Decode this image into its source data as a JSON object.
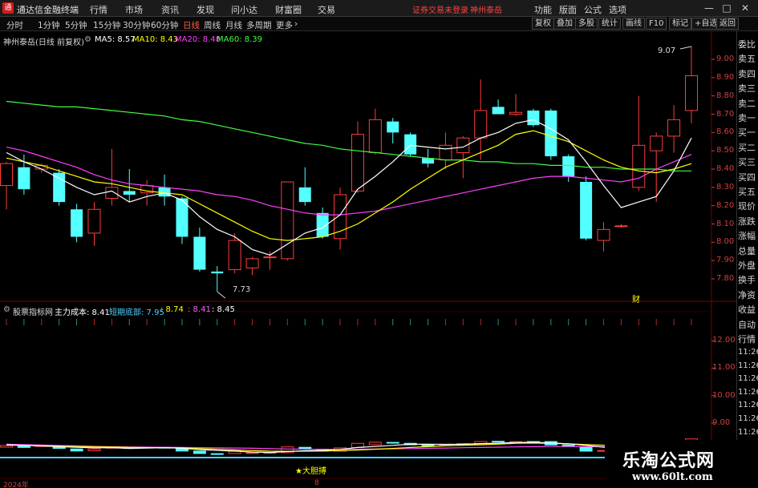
{
  "app": {
    "logo_char": "通",
    "title": "通达信金融终端",
    "menu": [
      "行情",
      "市场",
      "资讯",
      "发现",
      "问小达",
      "财富圈",
      "交易"
    ],
    "notice": "证券交易未登录",
    "notice_stock": "神州泰岳",
    "right_menu": [
      "功能",
      "版面",
      "公式",
      "选项"
    ],
    "window_buttons": [
      "—",
      "□",
      "✕"
    ]
  },
  "toolbar": {
    "periods": [
      "分时",
      "1分钟",
      "5分钟",
      "15分钟",
      "30分钟",
      "60分钟",
      "日线",
      "周线",
      "月线",
      "多周期",
      "更多"
    ],
    "active_period": "日线",
    "tools": [
      "复权",
      "叠加",
      "多股",
      "统计",
      "画线",
      "F10",
      "标记",
      "+自选",
      "返回"
    ]
  },
  "main_chart": {
    "stock_title": "神州泰岳(日线 前复权)",
    "ma5_label": "MA5: 8.57",
    "ma10_label": "MA10: 8.43",
    "ma20_label": "MA20: 8.48",
    "ma60_label": "MA60: 8.39",
    "high_marker": "9.07",
    "low_marker": "7.73",
    "event_marker": "财",
    "y_ticks": [
      "9.00",
      "8.90",
      "8.80",
      "8.70",
      "8.60",
      "8.50",
      "8.40",
      "8.30",
      "8.20",
      "8.10",
      "8.00",
      "7.90",
      "7.80"
    ]
  },
  "indicator": {
    "name": "股票指标网",
    "cost_label": "主力成本: 8.41",
    "bottom_label": "短期底部: 7.95",
    "v1": ": 8.74",
    "v2": ": 8.41",
    "v3": ": 8.45",
    "signal": "★大胆搏",
    "y_ticks": [
      "12.00",
      "11.00",
      "10.00",
      "9.00"
    ]
  },
  "side_panel": {
    "tabs": [
      "委比",
      "卖五",
      "卖四",
      "卖三",
      "卖二",
      "卖一",
      "买一",
      "买二",
      "买三",
      "买四",
      "买五",
      "现价",
      "涨跌",
      "涨幅",
      "总量",
      "外盘",
      "换手",
      "净资",
      "收益",
      "自动",
      "行情",
      "11:26",
      "11:26",
      "11:26",
      "11:26",
      "11:26",
      "11:26",
      "11:26",
      "11:26",
      "11:26",
      "11:26",
      "11:26"
    ]
  },
  "bottom": {
    "year": "2024年",
    "month": "8"
  },
  "watermark": {
    "title": "乐淘公式网",
    "url": "www.60lt.com"
  },
  "colors": {
    "up": "#ff3c3c",
    "down": "#54ffff",
    "ma5": "#ffffff",
    "ma10": "#ffff00",
    "ma20": "#ff40ff",
    "ma60": "#40ff40"
  },
  "candles": [
    {
      "o": 8.31,
      "h": 8.44,
      "l": 8.18,
      "c": 8.43
    },
    {
      "o": 8.41,
      "h": 8.48,
      "l": 8.26,
      "c": 8.29
    },
    {
      "o": 8.4,
      "h": 8.43,
      "l": 8.38,
      "c": 8.42
    },
    {
      "o": 8.38,
      "h": 8.4,
      "l": 8.2,
      "c": 8.22
    },
    {
      "o": 8.18,
      "h": 8.21,
      "l": 8.0,
      "c": 8.03
    },
    {
      "o": 8.05,
      "h": 8.22,
      "l": 7.98,
      "c": 8.18
    },
    {
      "o": 8.24,
      "h": 8.51,
      "l": 8.2,
      "c": 8.3
    },
    {
      "o": 8.28,
      "h": 8.4,
      "l": 8.22,
      "c": 8.26
    },
    {
      "o": 8.27,
      "h": 8.34,
      "l": 8.2,
      "c": 8.31
    },
    {
      "o": 8.3,
      "h": 8.37,
      "l": 8.2,
      "c": 8.25
    },
    {
      "o": 8.24,
      "h": 8.25,
      "l": 7.99,
      "c": 8.03
    },
    {
      "o": 8.03,
      "h": 8.08,
      "l": 7.84,
      "c": 7.85
    },
    {
      "o": 7.84,
      "h": 7.87,
      "l": 7.73,
      "c": 7.83
    },
    {
      "o": 7.85,
      "h": 8.05,
      "l": 7.83,
      "c": 8.01
    },
    {
      "o": 7.86,
      "h": 7.92,
      "l": 7.82,
      "c": 7.91
    },
    {
      "o": 7.92,
      "h": 7.95,
      "l": 7.85,
      "c": 7.92
    },
    {
      "o": 7.91,
      "h": 8.33,
      "l": 7.9,
      "c": 8.33
    },
    {
      "o": 8.3,
      "h": 8.41,
      "l": 8.2,
      "c": 8.22
    },
    {
      "o": 8.16,
      "h": 8.19,
      "l": 8.02,
      "c": 8.03
    },
    {
      "o": 8.02,
      "h": 8.3,
      "l": 7.96,
      "c": 8.26
    },
    {
      "o": 8.28,
      "h": 8.66,
      "l": 8.27,
      "c": 8.59
    },
    {
      "o": 8.49,
      "h": 8.73,
      "l": 8.48,
      "c": 8.67
    },
    {
      "o": 8.66,
      "h": 8.68,
      "l": 8.54,
      "c": 8.6
    },
    {
      "o": 8.59,
      "h": 8.6,
      "l": 8.47,
      "c": 8.48
    },
    {
      "o": 8.46,
      "h": 8.51,
      "l": 8.41,
      "c": 8.43
    },
    {
      "o": 8.45,
      "h": 8.6,
      "l": 8.4,
      "c": 8.53
    },
    {
      "o": 8.49,
      "h": 8.58,
      "l": 8.35,
      "c": 8.57
    },
    {
      "o": 8.57,
      "h": 8.89,
      "l": 8.45,
      "c": 8.72
    },
    {
      "o": 8.74,
      "h": 8.78,
      "l": 8.7,
      "c": 8.7
    },
    {
      "o": 8.7,
      "h": 8.81,
      "l": 8.69,
      "c": 8.71
    },
    {
      "o": 8.72,
      "h": 8.73,
      "l": 8.63,
      "c": 8.64
    },
    {
      "o": 8.72,
      "h": 8.73,
      "l": 8.45,
      "c": 8.47
    },
    {
      "o": 8.47,
      "h": 8.48,
      "l": 8.33,
      "c": 8.36
    },
    {
      "o": 8.33,
      "h": 8.36,
      "l": 8.01,
      "c": 8.02
    },
    {
      "o": 8.01,
      "h": 8.11,
      "l": 7.95,
      "c": 8.07
    },
    {
      "o": 8.09,
      "h": 8.1,
      "l": 8.08,
      "c": 8.09
    },
    {
      "o": 8.3,
      "h": 8.8,
      "l": 8.28,
      "c": 8.53
    },
    {
      "o": 8.5,
      "h": 8.6,
      "l": 8.22,
      "c": 8.58
    },
    {
      "o": 8.58,
      "h": 8.75,
      "l": 8.49,
      "c": 8.67
    },
    {
      "o": 8.72,
      "h": 9.07,
      "l": 8.65,
      "c": 8.91
    }
  ],
  "ma5": [
    8.49,
    8.44,
    8.4,
    8.35,
    8.3,
    8.26,
    8.28,
    8.22,
    8.25,
    8.27,
    8.23,
    8.14,
    8.07,
    8.03,
    7.96,
    7.93,
    7.99,
    8.05,
    8.08,
    8.15,
    8.29,
    8.36,
    8.44,
    8.53,
    8.52,
    8.51,
    8.52,
    8.57,
    8.6,
    8.65,
    8.67,
    8.62,
    8.56,
    8.44,
    8.31,
    8.19,
    8.22,
    8.25,
    8.39,
    8.57
  ],
  "ma10": [
    8.46,
    8.44,
    8.42,
    8.39,
    8.36,
    8.33,
    8.32,
    8.3,
    8.28,
    8.27,
    8.26,
    8.21,
    8.16,
    8.11,
    8.06,
    8.02,
    8.01,
    8.02,
    8.03,
    8.06,
    8.1,
    8.16,
    8.22,
    8.29,
    8.35,
    8.41,
    8.45,
    8.49,
    8.53,
    8.59,
    8.61,
    8.58,
    8.55,
    8.5,
    8.45,
    8.41,
    8.39,
    8.38,
    8.4,
    8.43
  ],
  "ma20": [
    8.52,
    8.5,
    8.47,
    8.44,
    8.41,
    8.37,
    8.34,
    8.32,
    8.31,
    8.3,
    8.29,
    8.28,
    8.26,
    8.25,
    8.23,
    8.2,
    8.18,
    8.16,
    8.15,
    8.15,
    8.16,
    8.17,
    8.19,
    8.21,
    8.23,
    8.25,
    8.27,
    8.29,
    8.31,
    8.33,
    8.35,
    8.36,
    8.36,
    8.35,
    8.34,
    8.33,
    8.35,
    8.4,
    8.44,
    8.48
  ],
  "ma60": [
    8.77,
    8.76,
    8.75,
    8.74,
    8.74,
    8.73,
    8.72,
    8.71,
    8.7,
    8.69,
    8.67,
    8.66,
    8.64,
    8.62,
    8.6,
    8.58,
    8.56,
    8.54,
    8.53,
    8.51,
    8.5,
    8.49,
    8.48,
    8.47,
    8.46,
    8.45,
    8.45,
    8.44,
    8.44,
    8.43,
    8.43,
    8.42,
    8.42,
    8.41,
    8.41,
    8.4,
    8.4,
    8.4,
    8.39,
    8.39
  ]
}
